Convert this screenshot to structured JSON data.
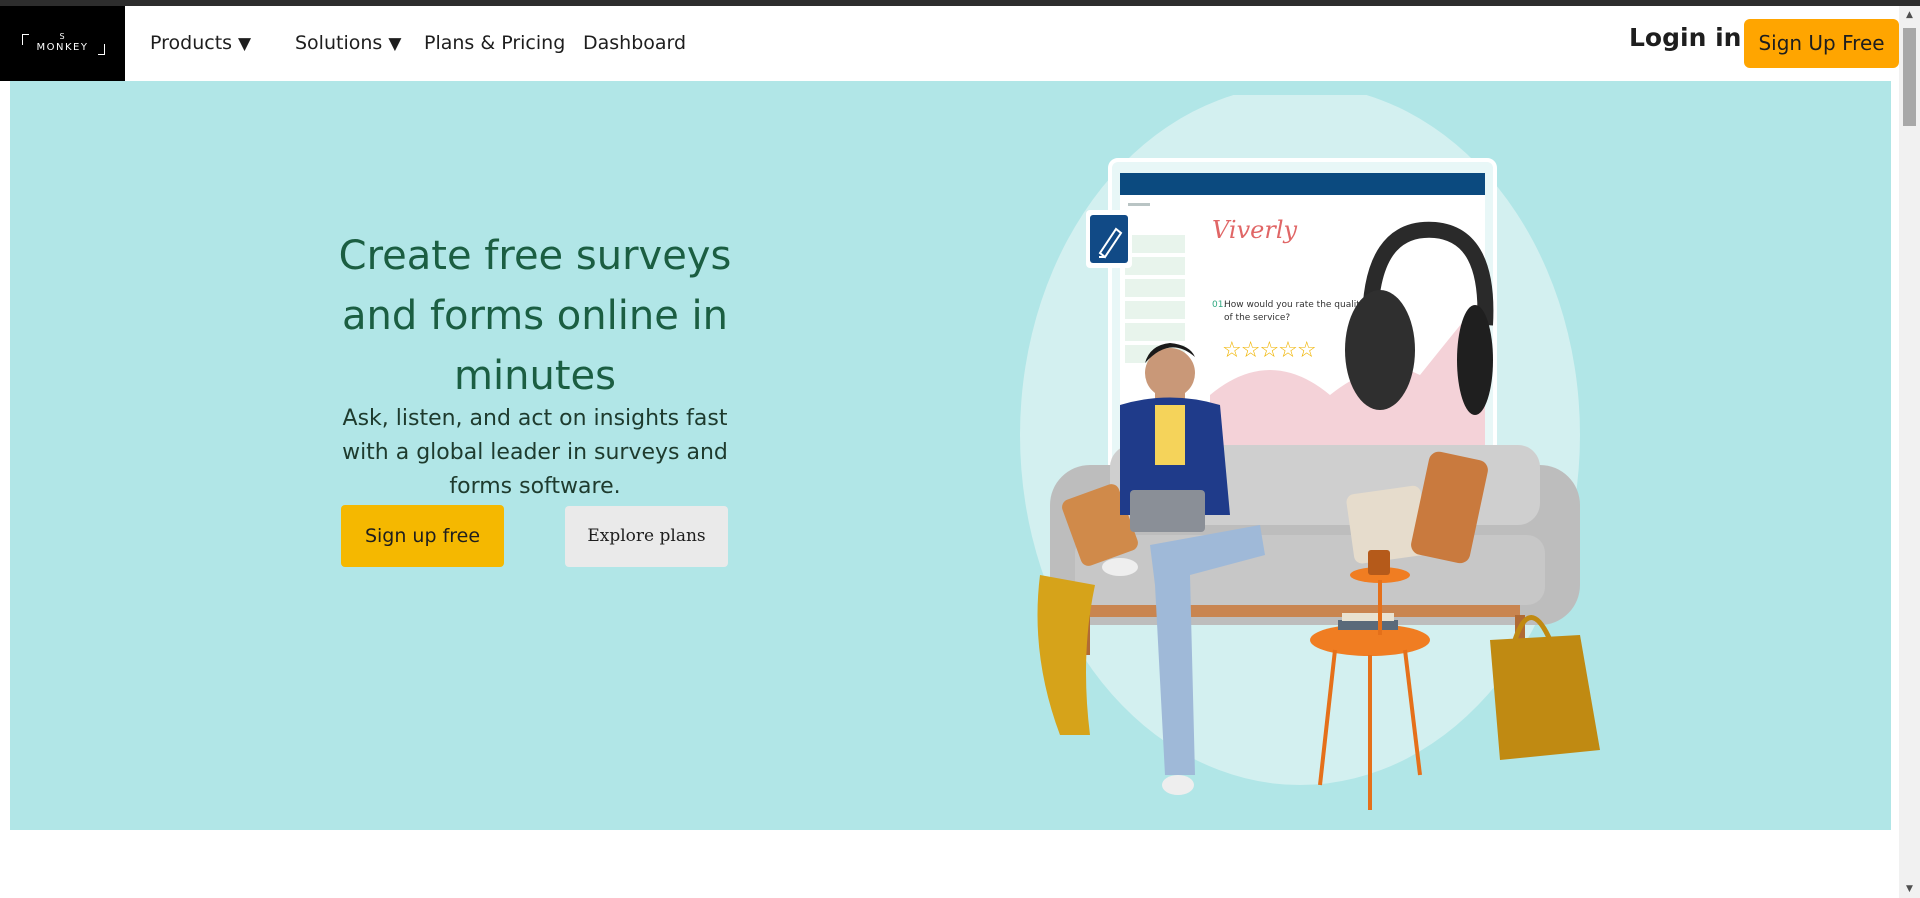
{
  "brand": {
    "logo_line1": "S",
    "logo_line2": "MONKEY"
  },
  "nav": {
    "products": "Products",
    "solutions": "Solutions",
    "pricing": "Plans & Pricing",
    "dashboard": "Dashboard",
    "caret": "▼",
    "login": "Login in",
    "signup": "Sign Up Free"
  },
  "hero": {
    "title": "Create free surveys and forms online in minutes",
    "subtitle": "Ask, listen, and act on insights fast with a global leader in surveys and forms software.",
    "primary_button": "Sign up free",
    "secondary_button": "Explore plans",
    "background_color": "#b1e6e7"
  },
  "illustration": {
    "survey_brand": "Viverly",
    "question_number": "01.",
    "question_line1": "How would you rate the quality",
    "question_line2": "of the service?",
    "stars": "☆☆☆☆☆",
    "edit_icon": "pencil-icon"
  },
  "colors": {
    "accent": "#ffa500",
    "primary_button": "#f5b800",
    "title_green": "#1b5e42"
  }
}
